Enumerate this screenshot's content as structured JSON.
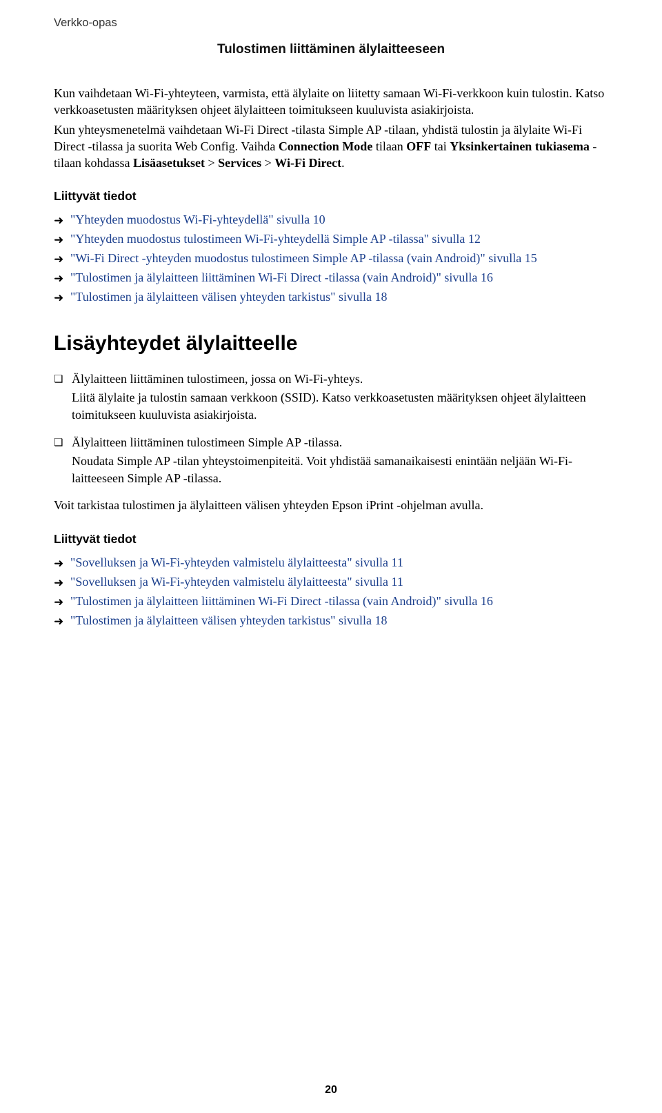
{
  "header": {
    "guide_label": "Verkko-opas",
    "section_title": "Tulostimen liittäminen älylaitteeseen"
  },
  "intro": {
    "p1": "Kun vaihdetaan Wi-Fi-yhteyteen, varmista, että älylaite on liitetty samaan Wi-Fi-verkkoon kuin tulostin. Katso verkkoasetusten määrityksen ohjeet älylaitteen toimitukseen kuuluvista asiakirjoista.",
    "p2a": "Kun yhteysmenetelmä vaihdetaan Wi-Fi Direct -tilasta Simple AP -tilaan, yhdistä tulostin ja älylaite Wi-Fi Direct -tilassa ja suorita Web Config. Vaihda ",
    "p2b_bold": "Connection Mode",
    "p2c": " tilaan ",
    "p2d_bold": "OFF",
    "p2e": " tai ",
    "p2f_bold": "Yksinkertainen tukiasema",
    "p2g": " -tilaan kohdassa ",
    "p2h_bold": "Lisäasetukset",
    "p2i": " > ",
    "p2j_bold": "Services",
    "p2k": " > ",
    "p2l_bold": "Wi-Fi Direct",
    "p2m": "."
  },
  "related1": {
    "heading": "Liittyvät tiedot",
    "items": [
      "\"Yhteyden muodostus Wi-Fi-yhteydellä\" sivulla 10",
      "\"Yhteyden muodostus tulostimeen Wi-Fi-yhteydellä Simple AP -tilassa\" sivulla 12",
      "\"Wi-Fi Direct -yhteyden muodostus tulostimeen Simple AP -tilassa (vain Android)\" sivulla 15",
      "\"Tulostimen ja älylaitteen liittäminen Wi-Fi Direct -tilassa (vain Android)\" sivulla 16",
      "\"Tulostimen ja älylaitteen välisen yhteyden tarkistus\" sivulla 18"
    ]
  },
  "h1": "Lisäyhteydet älylaitteelle",
  "checklist": [
    {
      "lead": "Älylaitteen liittäminen tulostimeen, jossa on Wi-Fi-yhteys.",
      "sub": "Liitä älylaite ja tulostin samaan verkkoon (SSID). Katso verkkoasetusten määrityksen ohjeet älylaitteen toimitukseen kuuluvista asiakirjoista."
    },
    {
      "lead": "Älylaitteen liittäminen tulostimeen Simple AP -tilassa.",
      "sub": "Noudata Simple AP -tilan yhteystoimenpiteitä. Voit yhdistää samanaikaisesti enintään neljään Wi-Fi-laitteeseen Simple AP -tilassa."
    }
  ],
  "after_checklist": "Voit tarkistaa tulostimen ja älylaitteen välisen yhteyden Epson iPrint -ohjelman avulla.",
  "related2": {
    "heading": "Liittyvät tiedot",
    "items": [
      "\"Sovelluksen ja Wi-Fi-yhteyden valmistelu älylaitteesta\" sivulla 11",
      "\"Sovelluksen ja Wi-Fi-yhteyden valmistelu älylaitteesta\" sivulla 11",
      "\"Tulostimen ja älylaitteen liittäminen Wi-Fi Direct -tilassa (vain Android)\" sivulla 16",
      "\"Tulostimen ja älylaitteen välisen yhteyden tarkistus\" sivulla 18"
    ]
  },
  "page_number": "20"
}
